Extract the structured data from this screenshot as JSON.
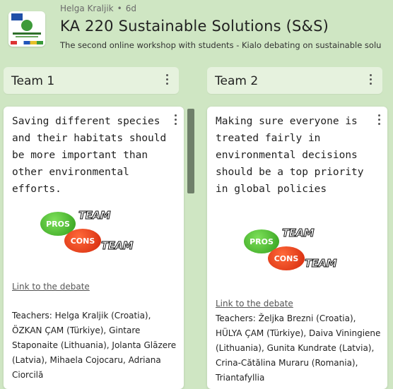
{
  "header": {
    "author": "Helga Kraljik",
    "age": "6d",
    "title": "KA 220 Sustainable Solutions (S&S)",
    "subtitle": "The second online workshop with students - Kialo debating on sustainable solu"
  },
  "columns": [
    {
      "name": "Team 1",
      "card": {
        "text": "Saving different species and their habitats should be more important than other environmental efforts.",
        "image": {
          "pros": "PROS",
          "cons": "CONS",
          "team": "TEAM"
        },
        "link": "Link to the debate",
        "teachers": "Teachers: Helga Kraljik (Croatia), ÖZKAN ÇAM (Türkiye), Gintare Staponaite (Lithuania), Jolanta Glāzere (Latvia), Mihaela Cojocaru, Adriana Ciorcilă"
      }
    },
    {
      "name": "Team 2",
      "card": {
        "text": "Making sure everyone is treated fairly in environmental decisions should be a top priority in global policies",
        "image": {
          "pros": "PROS",
          "cons": "CONS",
          "team": "TEAM"
        },
        "link": "Link to the debate",
        "teachers": "Teachers: Željka Brezni (Croatia), HÜLYA ÇAM (Türkiye), Daiva Viningiene (Lithuania), Gunita Kundrate (Latvia), Crina-Cătălina Muraru (Romania), Triantafyllia"
      }
    }
  ],
  "icons": {
    "menu": "more-vertical-icon"
  }
}
